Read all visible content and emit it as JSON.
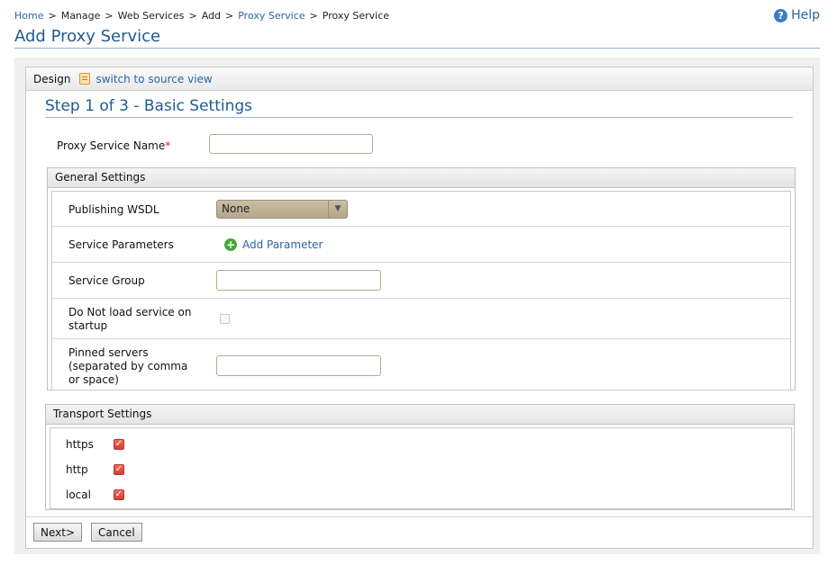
{
  "breadcrumb": {
    "home": "Home",
    "manage": "Manage",
    "web_services": "Web Services",
    "add": "Add",
    "proxy_service_link": "Proxy Service",
    "current": "Proxy Service",
    "separator": ">"
  },
  "help": {
    "icon": "question-circle-icon",
    "label": "Help"
  },
  "page": {
    "title": "Add Proxy Service"
  },
  "editor": {
    "design_label": "Design",
    "source_icon": "source-view-icon",
    "source_link": "switch to source view"
  },
  "step": {
    "title": "Step 1 of 3 - Basic Settings"
  },
  "proxy_name": {
    "label": "Proxy Service Name",
    "required_marker": "*",
    "value": ""
  },
  "general": {
    "heading": "General Settings",
    "publishing_wsdl": {
      "label": "Publishing WSDL",
      "selected": "None"
    },
    "service_parameters": {
      "label": "Service Parameters",
      "add_label": "Add Parameter",
      "add_icon": "plus-circle-icon"
    },
    "service_group": {
      "label": "Service Group",
      "value": ""
    },
    "do_not_load": {
      "label_line1": "Do Not load service on",
      "label_line2": "startup",
      "checked": false
    },
    "pinned_servers": {
      "label_line1": "Pinned servers",
      "label_line2": "(separated by comma",
      "label_line3": "or space)",
      "value": ""
    }
  },
  "transport": {
    "heading": "Transport Settings",
    "items": [
      {
        "label": "https",
        "checked": true
      },
      {
        "label": "http",
        "checked": true
      },
      {
        "label": "local",
        "checked": true
      }
    ]
  },
  "buttons": {
    "next": "Next>",
    "cancel": "Cancel"
  },
  "colors": {
    "link": "#2c64a8",
    "title": "#1f5a92",
    "required": "#dd2222",
    "checkbox_checked": "#d13f33",
    "add_icon": "#43a83a"
  }
}
